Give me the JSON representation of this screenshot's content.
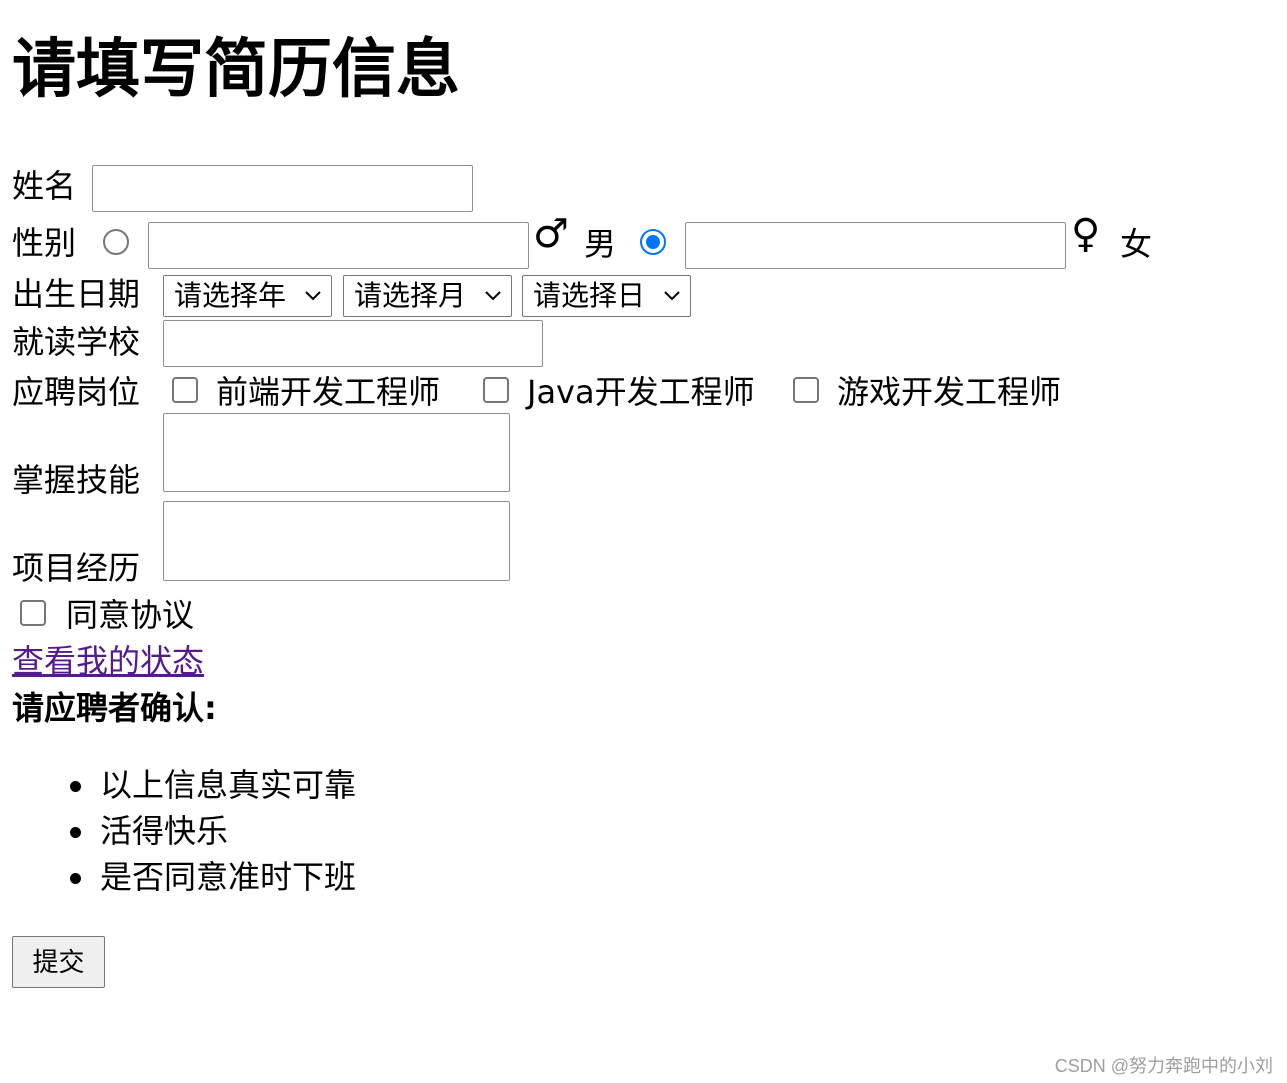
{
  "page": {
    "title": "请填写简历信息"
  },
  "form": {
    "name_label": "姓名",
    "name_value": "",
    "gender_label": "性别",
    "male_symbol": "♂",
    "male_label": "男",
    "female_symbol": "♀",
    "female_label": "女",
    "gender_selected": "女",
    "birth_label": "出生日期",
    "year_select": "请选择年",
    "month_select": "请选择月",
    "day_select": "请选择日",
    "school_label": "就读学校",
    "position_label": "应聘岗位",
    "positions": [
      {
        "label": "前端开发工程师",
        "checked": false
      },
      {
        "label": "Java开发工程师",
        "checked": false
      },
      {
        "label": "游戏开发工程师",
        "checked": false
      }
    ],
    "skills_label": "掌握技能",
    "projects_label": "项目经历",
    "agree_label": "同意协议",
    "status_link": "查看我的状态",
    "confirm_heading": "请应聘者确认:",
    "confirm_items": [
      "以上信息真实可靠",
      "活得快乐",
      "是否同意准时下班"
    ],
    "submit_label": "提交"
  },
  "watermark": "CSDN @努力奔跑中的小刘",
  "colors": {
    "accent": "#0075ff",
    "link_visited": "#551a8b",
    "watermark": "#9e9e9e"
  }
}
